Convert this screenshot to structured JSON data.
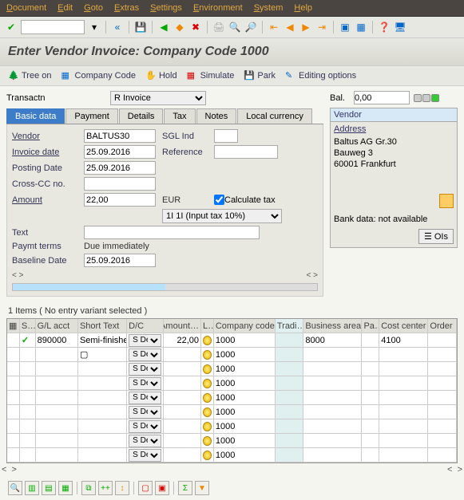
{
  "menu": [
    "Document",
    "Edit",
    "Goto",
    "Extras",
    "Settings",
    "Environment",
    "System",
    "Help"
  ],
  "title": "Enter Vendor Invoice: Company Code 1000",
  "apptb": {
    "tree": "Tree on",
    "cc": "Company Code",
    "hold": "Hold",
    "sim": "Simulate",
    "park": "Park",
    "edit": "Editing options"
  },
  "trans": {
    "label": "Transactn",
    "value": "R Invoice"
  },
  "tabs": [
    "Basic data",
    "Payment",
    "Details",
    "Tax",
    "Notes",
    "Local currency"
  ],
  "form": {
    "vendor_lbl": "Vendor",
    "vendor": "BALTUS30",
    "sgl_lbl": "SGL Ind",
    "invdate_lbl": "Invoice date",
    "invdate": "25.09.2016",
    "ref_lbl": "Reference",
    "postdate_lbl": "Posting Date",
    "postdate": "25.09.2016",
    "crosscc_lbl": "Cross-CC no.",
    "amount_lbl": "Amount",
    "amount": "22,00",
    "curr": "EUR",
    "calctax": "Calculate tax",
    "taxcode": "1I 1I (Input tax 10%)",
    "text_lbl": "Text",
    "payterm_lbl": "Paymt terms",
    "payterm": "Due immediately",
    "baseline_lbl": "Baseline Date",
    "baseline": "25.09.2016"
  },
  "bal": {
    "label": "Bal.",
    "value": "0,00"
  },
  "vendor_panel": {
    "hdr": "Vendor",
    "addr": "Address",
    "l1": "Baltus AG Gr.30",
    "l2": "Bauweg 3",
    "l3": "60001 Frankfurt",
    "bank": "Bank data: not available",
    "ois": "OIs"
  },
  "items_hdr": "1 Items ( No entry variant selected )",
  "grid": {
    "cols": [
      "",
      "S…",
      "G/L acct",
      "Short Text",
      "D/C",
      "Amount…",
      "L…",
      "Company code",
      "Tradi…",
      "Business area",
      "Pa…",
      "Cost center",
      "Order"
    ],
    "dc": "S De…",
    "rows": [
      {
        "st": "✓",
        "gl": "890000",
        "sh": "Semi-finishe…",
        "am": "22,00",
        "cc": "1000",
        "ba": "8000",
        "co": "4100"
      },
      {
        "cc": "1000"
      },
      {
        "cc": "1000"
      },
      {
        "cc": "1000"
      },
      {
        "cc": "1000"
      },
      {
        "cc": "1000"
      },
      {
        "cc": "1000"
      },
      {
        "cc": "1000"
      },
      {
        "cc": "1000"
      }
    ]
  }
}
